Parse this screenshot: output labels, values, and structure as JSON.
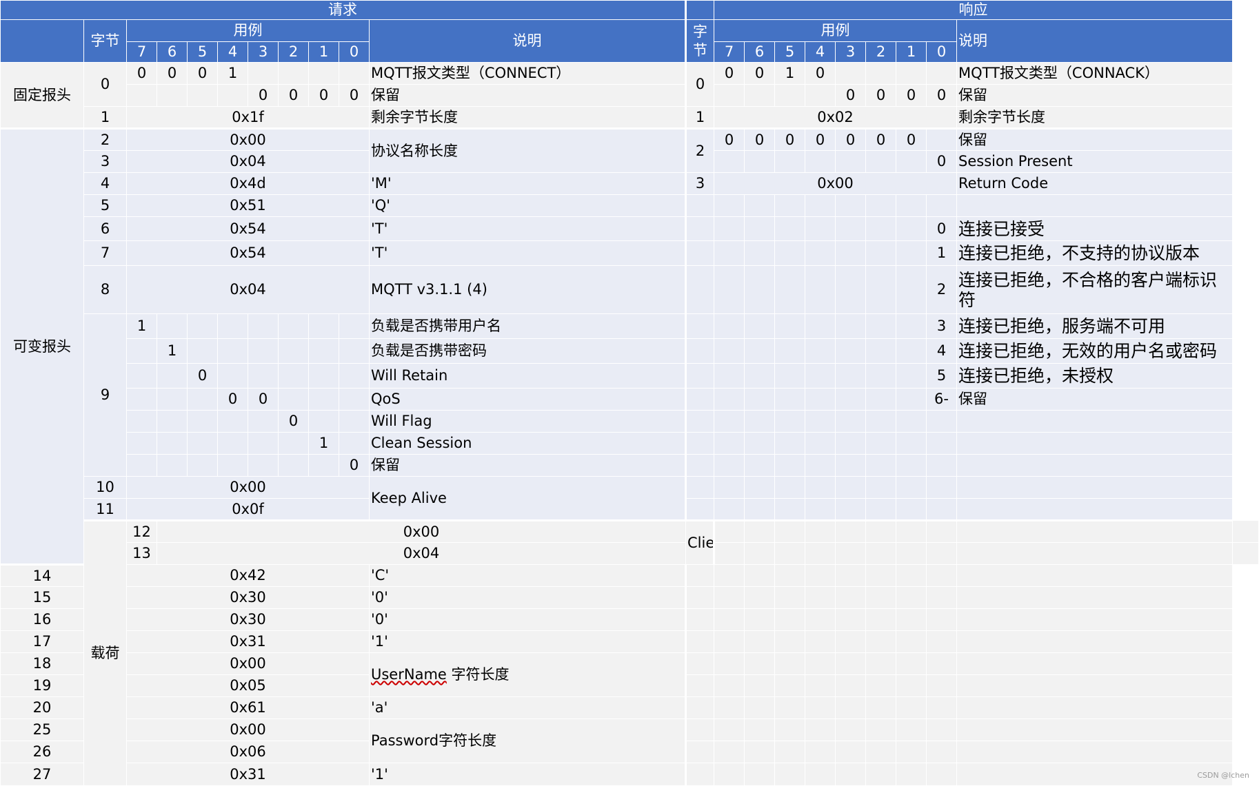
{
  "header": {
    "request": "请求",
    "response": "响应",
    "byte_req": "字节",
    "byte_resp": "字节",
    "example": "用例",
    "desc": "说明",
    "bits": [
      "7",
      "6",
      "5",
      "4",
      "3",
      "2",
      "1",
      "0"
    ]
  },
  "sections": {
    "fixed": "固定报头",
    "variable": "可变报头",
    "payload": "载荷"
  },
  "request": {
    "b0": {
      "byte": "0",
      "bits_hi": [
        "0",
        "0",
        "0",
        "1"
      ],
      "desc_hi": "MQTT报文类型（CONNECT）",
      "bits_lo": [
        "0",
        "0",
        "0",
        "0"
      ],
      "desc_lo": "保留"
    },
    "b1": {
      "byte": "1",
      "val": "0x1f",
      "desc": "剩余字节长度"
    },
    "b2": {
      "byte": "2",
      "val": "0x00"
    },
    "b3": {
      "byte": "3",
      "val": "0x04"
    },
    "b23_desc": "协议名称长度",
    "b4": {
      "byte": "4",
      "val": "0x4d",
      "desc": "'M'"
    },
    "b5": {
      "byte": "5",
      "val": "0x51",
      "desc": "'Q'"
    },
    "b6": {
      "byte": "6",
      "val": "0x54",
      "desc": "'T'"
    },
    "b7": {
      "byte": "7",
      "val": "0x54",
      "desc": "'T'"
    },
    "b8": {
      "byte": "8",
      "val": "0x04",
      "desc": "MQTT v3.1.1 (4)"
    },
    "b9": {
      "byte": "9",
      "flags": [
        {
          "bit": "1",
          "desc": "负载是否携带用户名"
        },
        {
          "bit": "1",
          "desc": "负载是否携带密码"
        },
        {
          "bit": "0",
          "desc": "Will Retain"
        },
        {
          "bit4": "0",
          "bit3": "0",
          "desc": "QoS"
        },
        {
          "bit": "0",
          "desc": "Will Flag"
        },
        {
          "bit": "1",
          "desc": "Clean Session"
        },
        {
          "bit": "0",
          "desc": "保留"
        }
      ]
    },
    "b10": {
      "byte": "10",
      "val": "0x00"
    },
    "b11": {
      "byte": "11",
      "val": "0x0f"
    },
    "b1011_desc": "Keep Alive",
    "b12": {
      "byte": "12",
      "val": "0x00"
    },
    "b13": {
      "byte": "13",
      "val": "0x04"
    },
    "b1213_desc": "Client Id 字符长度",
    "b14": {
      "byte": "14",
      "val": "0x42",
      "desc": "'C'"
    },
    "b15": {
      "byte": "15",
      "val": "0x30",
      "desc": "'0'"
    },
    "b16": {
      "byte": "16",
      "val": "0x30",
      "desc": "'0'"
    },
    "b17": {
      "byte": "17",
      "val": "0x31",
      "desc": "'1'"
    },
    "b18": {
      "byte": "18",
      "val": "0x00"
    },
    "b19": {
      "byte": "19",
      "val": "0x05"
    },
    "b1819_desc_word": "UserName",
    "b1819_desc_rest": " 字符长度",
    "b20": {
      "byte": "20",
      "val": "0x61",
      "desc": "'a'"
    },
    "b25": {
      "byte": "25",
      "val": "0x00"
    },
    "b26": {
      "byte": "26",
      "val": "0x06"
    },
    "b2526_desc": "Password字符长度",
    "b27": {
      "byte": "27",
      "val": "0x31",
      "desc": "'1'"
    }
  },
  "response": {
    "b0": {
      "byte": "0",
      "bits_hi": [
        "0",
        "0",
        "1",
        "0"
      ],
      "desc_hi": "MQTT报文类型（CONNACK）",
      "bits_lo": [
        "0",
        "0",
        "0",
        "0"
      ],
      "desc_lo": "保留"
    },
    "b1": {
      "byte": "1",
      "val": "0x02",
      "desc": "剩余字节长度"
    },
    "b2": {
      "byte": "2",
      "bits_hi": [
        "0",
        "0",
        "0",
        "0",
        "0",
        "0",
        "0"
      ],
      "desc_hi": "保留",
      "bit0": "0",
      "desc_lo": "Session Present"
    },
    "b3": {
      "byte": "3",
      "val": "0x00",
      "desc": "Return Code"
    },
    "codes": [
      {
        "code": "0",
        "desc": "连接已接受"
      },
      {
        "code": "1",
        "desc": "连接已拒绝，不支持的协议版本"
      },
      {
        "code": "2",
        "desc": "连接已拒绝，不合格的客户端标识符"
      },
      {
        "code": "3",
        "desc": "连接已拒绝，服务端不可用"
      },
      {
        "code": "4",
        "desc": "连接已拒绝，无效的用户名或密码"
      },
      {
        "code": "5",
        "desc": "连接已拒绝，未授权"
      },
      {
        "code": "6-",
        "desc": "保留"
      }
    ]
  },
  "watermark": "CSDN @lchen"
}
